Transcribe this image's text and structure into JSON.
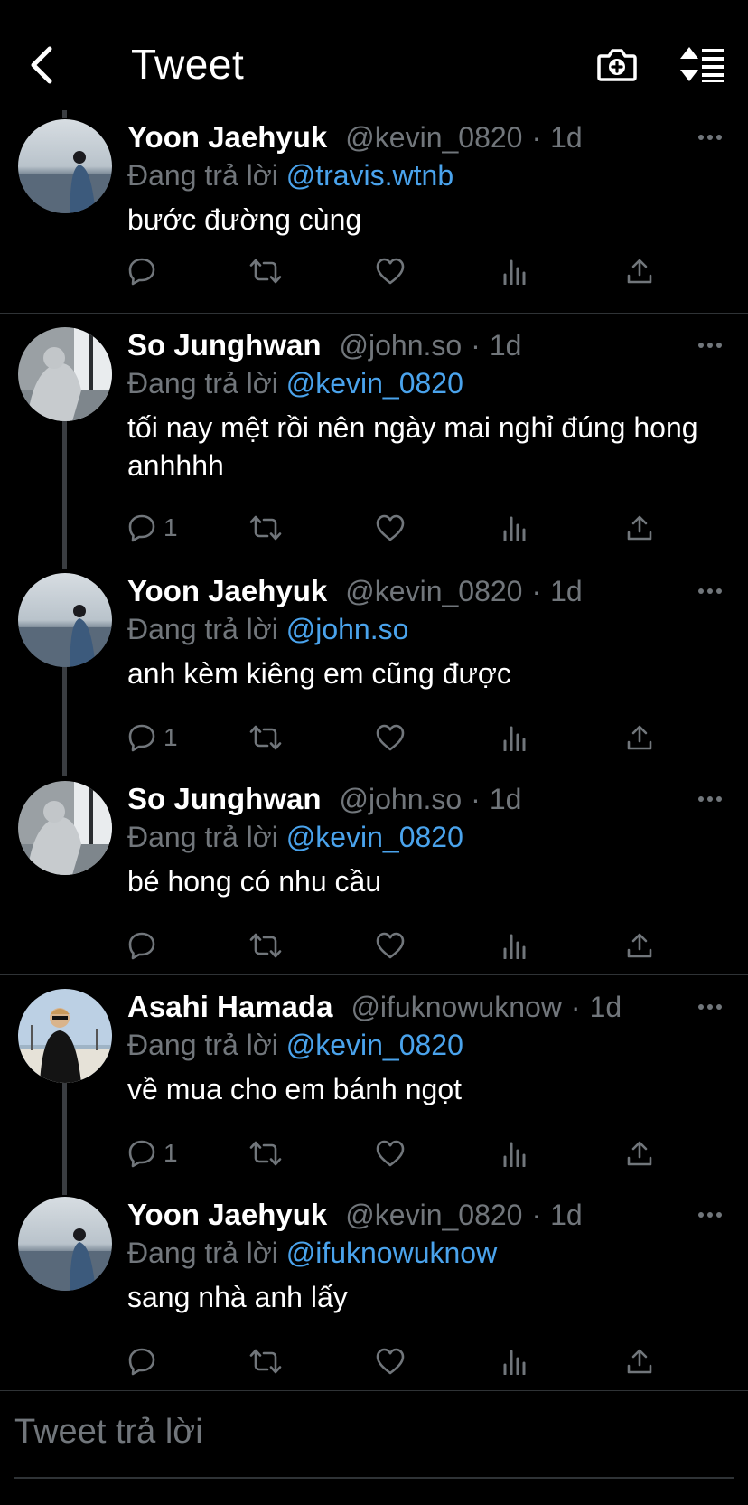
{
  "header": {
    "title": "Tweet",
    "back_icon": "chevron-left-icon",
    "camera_icon": "camera-plus-icon",
    "sort_icon": "sort-icon"
  },
  "tweets": [
    {
      "name": "Yoon Jaehyuk",
      "handle": "@kevin_0820",
      "sep": "·",
      "time": "1d",
      "reply_prefix": "Đang trả lời ",
      "reply_to": "@travis.wtnb",
      "text": "bước đường cùng",
      "reply_count": "",
      "avatar": "ocean"
    },
    {
      "name": "So Junghwan",
      "handle": "@john.so",
      "sep": "·",
      "time": "1d",
      "reply_prefix": "Đang trả lời ",
      "reply_to": "@kevin_0820",
      "text": "tối nay mệt rồi nên ngày mai nghỉ đúng hong anhhhh",
      "reply_count": "1",
      "avatar": "grey"
    },
    {
      "name": "Yoon Jaehyuk",
      "handle": "@kevin_0820",
      "sep": "·",
      "time": "1d",
      "reply_prefix": "Đang trả lời ",
      "reply_to": "@john.so",
      "text": "anh kèm kiêng em cũng được",
      "reply_count": "1",
      "avatar": "ocean"
    },
    {
      "name": "So Junghwan",
      "handle": "@john.so",
      "sep": "·",
      "time": "1d",
      "reply_prefix": "Đang trả lời ",
      "reply_to": "@kevin_0820",
      "text": "bé hong có nhu cầu",
      "reply_count": "",
      "avatar": "grey"
    },
    {
      "name": "Asahi Hamada",
      "handle": "@ifuknowuknow",
      "sep": "·",
      "time": "1d",
      "reply_prefix": "Đang trả lời ",
      "reply_to": "@kevin_0820",
      "text": "về mua cho em bánh ngọt",
      "reply_count": "1",
      "avatar": "beach"
    },
    {
      "name": "Yoon Jaehyuk",
      "handle": "@kevin_0820",
      "sep": "·",
      "time": "1d",
      "reply_prefix": "Đang trả lời ",
      "reply_to": "@ifuknowuknow",
      "text": "sang nhà anh lấy",
      "reply_count": "",
      "avatar": "ocean"
    }
  ],
  "reply_box": {
    "placeholder": "Tweet trả lời"
  },
  "colors": {
    "background": "#000000",
    "text": "#ffffff",
    "muted": "#71767b",
    "mention": "#4aa3ec",
    "divider": "#2f3336"
  }
}
